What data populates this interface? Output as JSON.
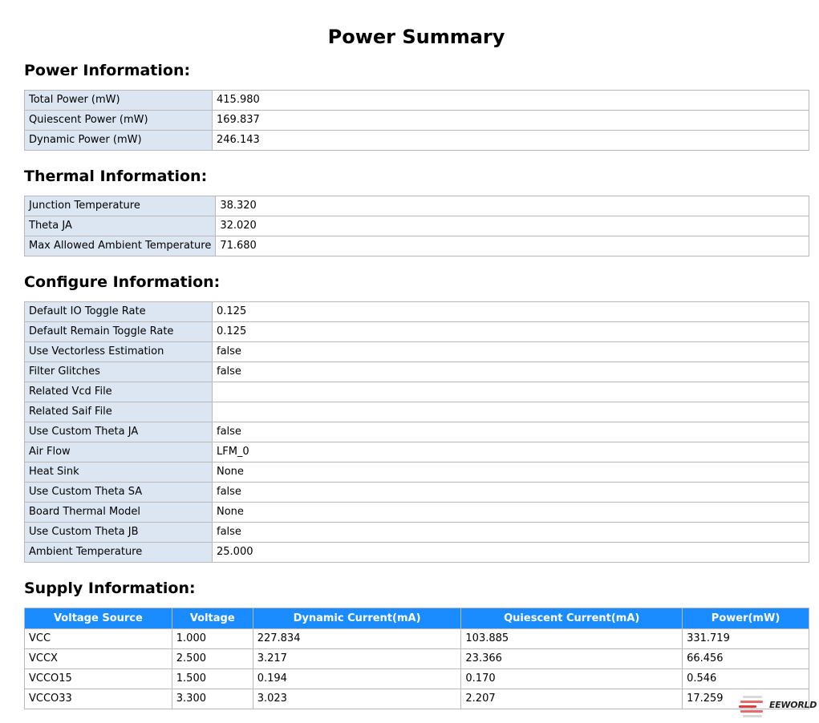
{
  "page_title": "Power Summary",
  "power": {
    "title": "Power Information:",
    "rows": [
      {
        "label": "Total Power (mW)",
        "value": "415.980"
      },
      {
        "label": "Quiescent Power (mW)",
        "value": "169.837"
      },
      {
        "label": "Dynamic Power (mW)",
        "value": "246.143"
      }
    ]
  },
  "thermal": {
    "title": "Thermal Information:",
    "rows": [
      {
        "label": "Junction Temperature",
        "value": "38.320"
      },
      {
        "label": "Theta JA",
        "value": "32.020"
      },
      {
        "label": "Max Allowed Ambient Temperature",
        "value": "71.680"
      }
    ]
  },
  "configure": {
    "title": "Configure Information:",
    "rows": [
      {
        "label": "Default IO Toggle Rate",
        "value": "0.125"
      },
      {
        "label": "Default Remain Toggle Rate",
        "value": "0.125"
      },
      {
        "label": "Use Vectorless Estimation",
        "value": "false"
      },
      {
        "label": "Filter Glitches",
        "value": "false"
      },
      {
        "label": "Related Vcd File",
        "value": ""
      },
      {
        "label": "Related Saif File",
        "value": ""
      },
      {
        "label": "Use Custom Theta JA",
        "value": "false"
      },
      {
        "label": "Air Flow",
        "value": "LFM_0"
      },
      {
        "label": "Heat Sink",
        "value": "None"
      },
      {
        "label": "Use Custom Theta SA",
        "value": "false"
      },
      {
        "label": "Board Thermal Model",
        "value": "None"
      },
      {
        "label": "Use Custom Theta JB",
        "value": "false"
      },
      {
        "label": "Ambient Temperature",
        "value": "25.000"
      }
    ]
  },
  "supply": {
    "title": "Supply Information:",
    "headers": [
      "Voltage Source",
      "Voltage",
      "Dynamic Current(mA)",
      "Quiescent Current(mA)",
      "Power(mW)"
    ],
    "rows": [
      [
        "VCC",
        "1.000",
        "227.834",
        "103.885",
        "331.719"
      ],
      [
        "VCCX",
        "2.500",
        "3.217",
        "23.366",
        "66.456"
      ],
      [
        "VCCO15",
        "1.500",
        "0.194",
        "0.170",
        "0.546"
      ],
      [
        "VCCO33",
        "3.300",
        "3.023",
        "2.207",
        "17.259"
      ]
    ]
  },
  "watermark": {
    "text": "EEWORLD",
    "subtext": "电子工程世界"
  },
  "colors": {
    "key_cell_bg": "#dce6f3",
    "header_bg": "#1a8cff",
    "border": "#b9b9b9"
  }
}
